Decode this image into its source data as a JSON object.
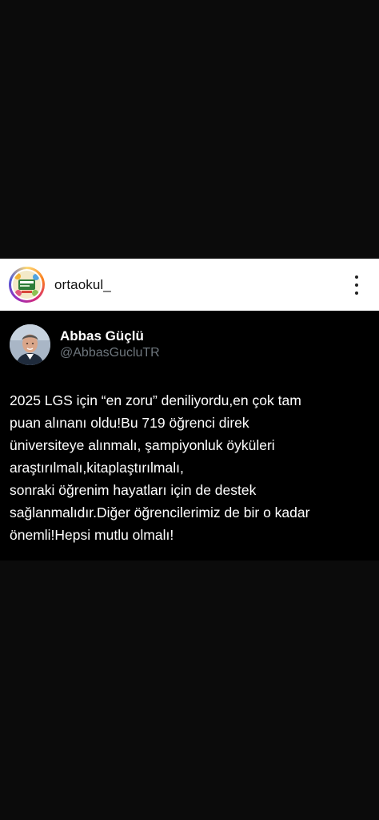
{
  "post_header": {
    "username": "ortaokul_",
    "avatar_icon": "ortaokul-logo-icon",
    "more_icon": "more-vertical-icon"
  },
  "tweet": {
    "author_name": "Abbas Güçlü",
    "author_handle": "@AbbasGucluTR",
    "text_lines": [
      "2025 LGS için “en zoru” deniliyordu,en çok tam",
      "puan alınanı oldu!Bu 719 öğrenci direk",
      "üniversiteye alınmalı, şampiyonluk öyküleri",
      "araştırılmalı,kitaplaştırılmalı,",
      "sonraki öğrenim hayatları için de destek",
      "sağlanmalıdır.Diğer öğrencilerimiz de bir o kadar",
      "önemli!Hepsi mutlu olmalı!"
    ]
  },
  "colors": {
    "background": "#0b0b0b",
    "header_bg": "#ffffff",
    "tweet_bg": "#000000",
    "handle": "#6e767d"
  }
}
